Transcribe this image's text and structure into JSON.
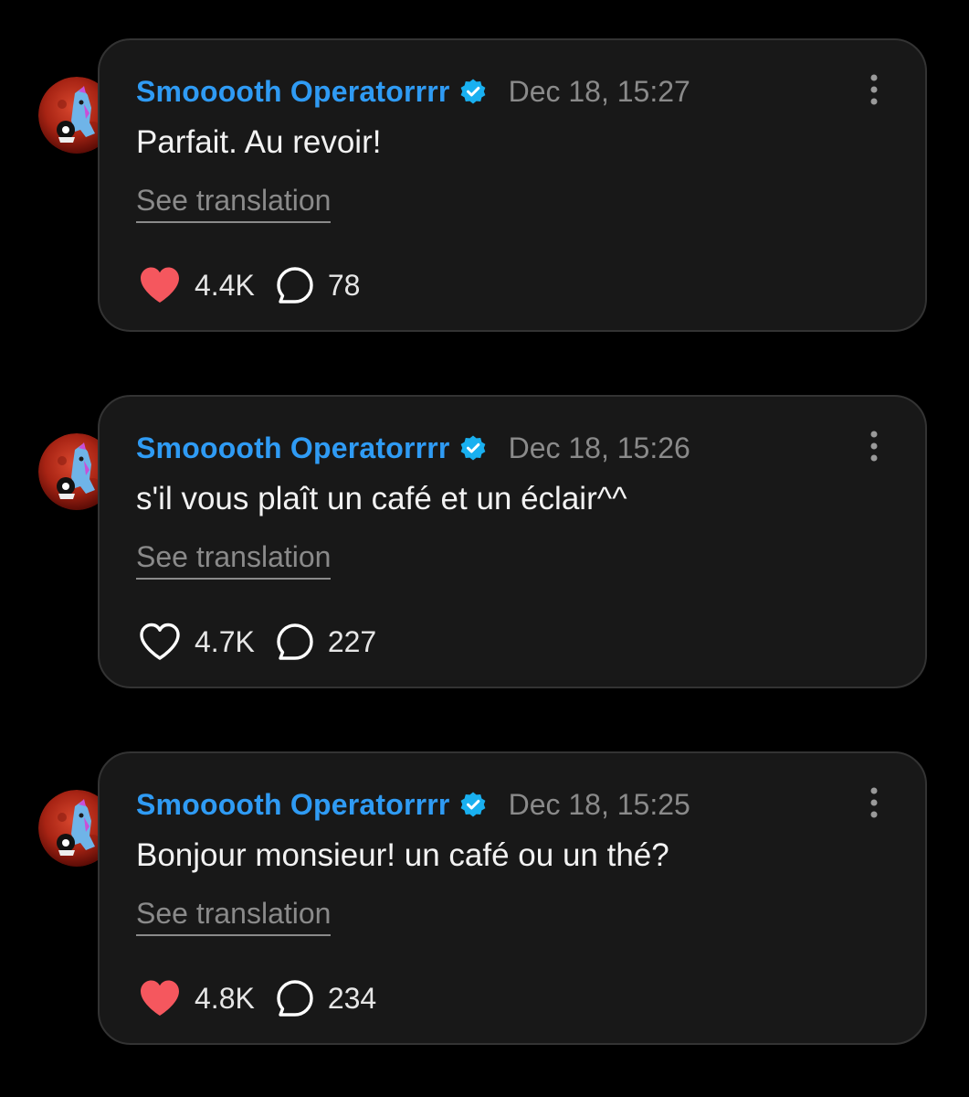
{
  "colors": {
    "background": "#000000",
    "card": "#181818",
    "card_border": "#333333",
    "username": "#2f9bf4",
    "verified_badge": "#19b0f0",
    "secondary_text": "#8a8a8a",
    "liked_heart": "#f5575e"
  },
  "posts": [
    {
      "username": "Smooooth Operatorrrr",
      "verified_icon": "verified-badge-icon",
      "timestamp": "Dec 18, 15:27",
      "text": "Parfait. Au revoir!",
      "translate_label": "See translation",
      "liked": true,
      "likes": "4.4K",
      "replies": "78"
    },
    {
      "username": "Smooooth Operatorrrr",
      "verified_icon": "verified-badge-icon",
      "timestamp": "Dec 18, 15:26",
      "text": "s'il vous plaît un café et un éclair^^",
      "translate_label": "See translation",
      "liked": false,
      "likes": "4.7K",
      "replies": "227"
    },
    {
      "username": "Smooooth Operatorrrr",
      "verified_icon": "verified-badge-icon",
      "timestamp": "Dec 18, 15:25",
      "text": "Bonjour monsieur! un café ou un thé?",
      "translate_label": "See translation",
      "liked": true,
      "likes": "4.8K",
      "replies": "234"
    }
  ]
}
